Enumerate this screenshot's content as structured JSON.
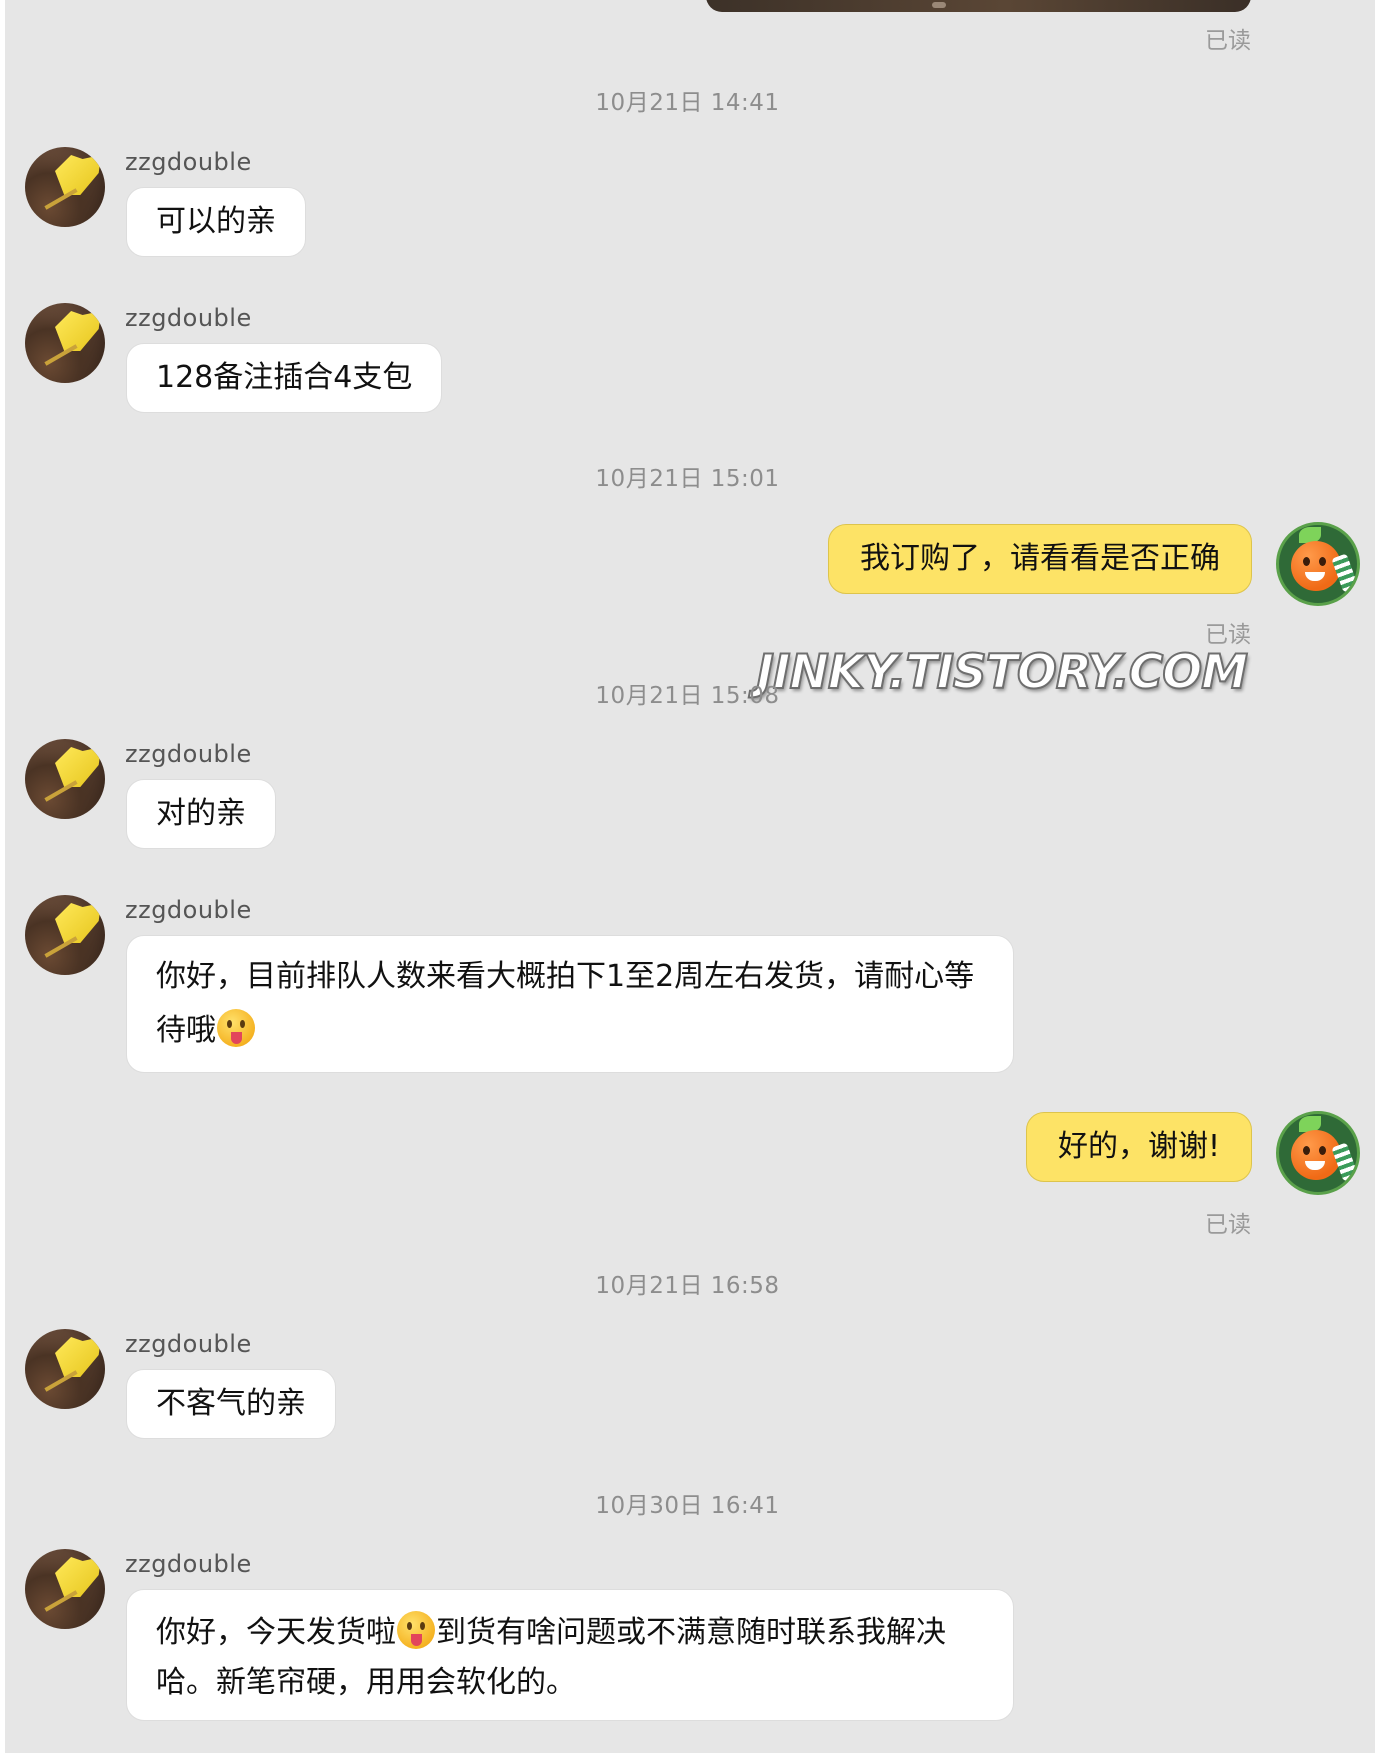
{
  "chat": {
    "seller_name": "zzgdouble",
    "read_label": "已读",
    "timestamps": {
      "t1": "10月21日 14:41",
      "t2": "10月21日 15:01",
      "t3": "10月21日 15:08",
      "t4": "10月21日 16:58",
      "t5": "10月30日 16:41"
    },
    "messages": {
      "m1": "可以的亲",
      "m2": "128备注插合4支包",
      "m3": "我订购了，请看看是否正确",
      "m4": "对的亲",
      "m5a": "你好，目前排队人数来看大概拍下1至2周左右发货，请耐心等待哦",
      "m6": "好的，谢谢!",
      "m7": "不客气的亲",
      "m8a": "你好，今天发货啦",
      "m8b": "到货有啥问题或不满意随时联系我解决哈。新笔帘硬，用用会软化的。"
    },
    "emoji_name": "tongue-out-emoji"
  },
  "watermark": "JINKY.TISTORY.COM"
}
